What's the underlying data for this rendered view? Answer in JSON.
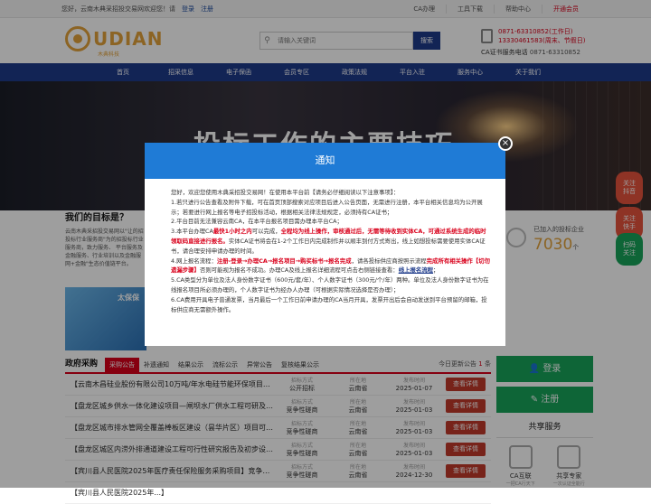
{
  "topbar": {
    "greeting": "您好，云南木典采招投交易网欢迎您！请",
    "login": "登录",
    "register": "注册",
    "links": [
      "CA办理",
      "工具下载",
      "帮助中心"
    ],
    "vip": "开通会员"
  },
  "header": {
    "logo_text": "UDIAN",
    "logo_sub": "木典科技",
    "search_placeholder": "请输入关键词",
    "search_button": "搜索",
    "phone1": "0871-63310852(工作日)",
    "phone2": "13330461583(周末、节假日)",
    "ca_label": "CA证书服务电话",
    "ca_phone": "0871-63310852"
  },
  "nav": [
    "首页",
    "招采信息",
    "电子保函",
    "会员专区",
    "政策法规",
    "平台入驻",
    "服务中心",
    "关于我们"
  ],
  "banner": {
    "title": "投标工作的主要技巧"
  },
  "goal": {
    "title": "我们的目标是？",
    "text": "云南木典采招投交易网以\"让的招投标行业服务商\"为的招投标行业服务商，致力服务、 平台服务及金融服务、行业培训以及金融服网+金融\"生态价值链平台。",
    "img_text": "太保保"
  },
  "stats": {
    "label": "已加入的投标企业",
    "value": "7030",
    "unit": "个"
  },
  "float": [
    {
      "l1": "关注",
      "l2": "抖音"
    },
    {
      "l1": "关注",
      "l2": "快手"
    },
    {
      "l1": "扫码",
      "l2": "关注"
    }
  ],
  "procurement": {
    "title": "政府采购",
    "tabs": [
      "采购公告",
      "补遗通知",
      "结果公示",
      "流标公示",
      "异常公告",
      "复核结果公示"
    ],
    "today_prefix": "今日更新公告",
    "today_count": "1",
    "col_keys": [
      "招标方式",
      "所在地",
      "发布时间"
    ],
    "detail_button": "查看详情",
    "rows": [
      {
        "title": "【云南木昌硅业股份有限公司10万吨/年水电硅节能环保项目获...",
        "method": "公开招标",
        "region": "云南省",
        "date": "2025-01-07"
      },
      {
        "title": "【盘龙区城乡供水一体化建设项目—闸坝水厂供水工程可研及初步...",
        "method": "竞争性磋商",
        "region": "云南省",
        "date": "2025-01-03"
      },
      {
        "title": "【盘龙区城市排水管网全覆盖棒板区建设（昙华片区）项目可研及...",
        "method": "竞争性磋商",
        "region": "云南省",
        "date": "2025-01-03"
      },
      {
        "title": "【盘龙区城区内涝外排通道建设工程可行性研究报告及初步设计编...",
        "method": "竞争性磋商",
        "region": "云南省",
        "date": "2025-01-03"
      },
      {
        "title": "【宾川县人民医院2025年医疗责任保险服务采购项目】竞争性...",
        "method": "竞争性磋商",
        "region": "云南省",
        "date": "2024-12-30"
      },
      {
        "title": "【宾川县人民医院2025年...】",
        "method": "",
        "region": "",
        "date": ""
      }
    ]
  },
  "side": {
    "login": "登录",
    "register": "注册",
    "share_title": "共享服务",
    "services": [
      {
        "name": "CA互联",
        "sub": "一把CA行天下"
      },
      {
        "name": "共享专家",
        "sub": "一次认证全能行"
      }
    ]
  },
  "modal": {
    "title": "通知",
    "intro": "您好，欢迎您使用木典采招投交易网！在使用本平台前【请务必仔细阅读以下注意事项】：",
    "p1": "1.若只进行公告查看及附件下载，可在首页顶部搜索对应项目后进入公告页面，无需进行注册，本平台相关信息均为公开展示；若要进行网上报名等电子招投标活动，根据相关法律法规规定，必须持有CA证书；",
    "p2": "2.平台目前无法兼容云南CA，在本平台报名项目需办理本平台CA；",
    "p3a": "3.本平台办理CA",
    "p3b": "最快1小时之内",
    "p3c": "可以完成，",
    "p3d": "全程均为线上操作，审核通过后，无需等待收到实体CA，可通过系统生成的临时领取码直接进行报名。",
    "p3e": "实体CA证书将会在1-2个工作日内完成制作并以顺丰到付方式寄出，线上如想投标需要使用实体CA证书，请合理安排申请办理的时间。",
    "p4a": "4.网上报名流程：",
    "p4b": "注册-登录→办理CA→报名项目→购买标书→报名完成",
    "p4c": "，请各投标供应商按照示流程",
    "p4d": "完成所有相关操作【切勿遗漏步骤】",
    "p4e": "否则可能视为报名不成功。办理CA及线上报名详细流程可点击右侧链接查看：",
    "p4f": "线上报名流程",
    "p4g": "；",
    "p5": "5.CA类型分为单位及法人身份数字证书（600元/套/年）、个人数字证书（300元/个/年）两种。单位及法人身份数字证书为在线报名项目所必须办理的，个人数字证书为经办人办理（可根据实际情况选择是否办理）；",
    "p6": "6.CA费用开具电子普通发票，当月最后一个工作日前申请办理的CA当月开具，发票开出后会自动发送到平台预留的邮箱，投标供应商无需额外操作。",
    "close": "×"
  }
}
